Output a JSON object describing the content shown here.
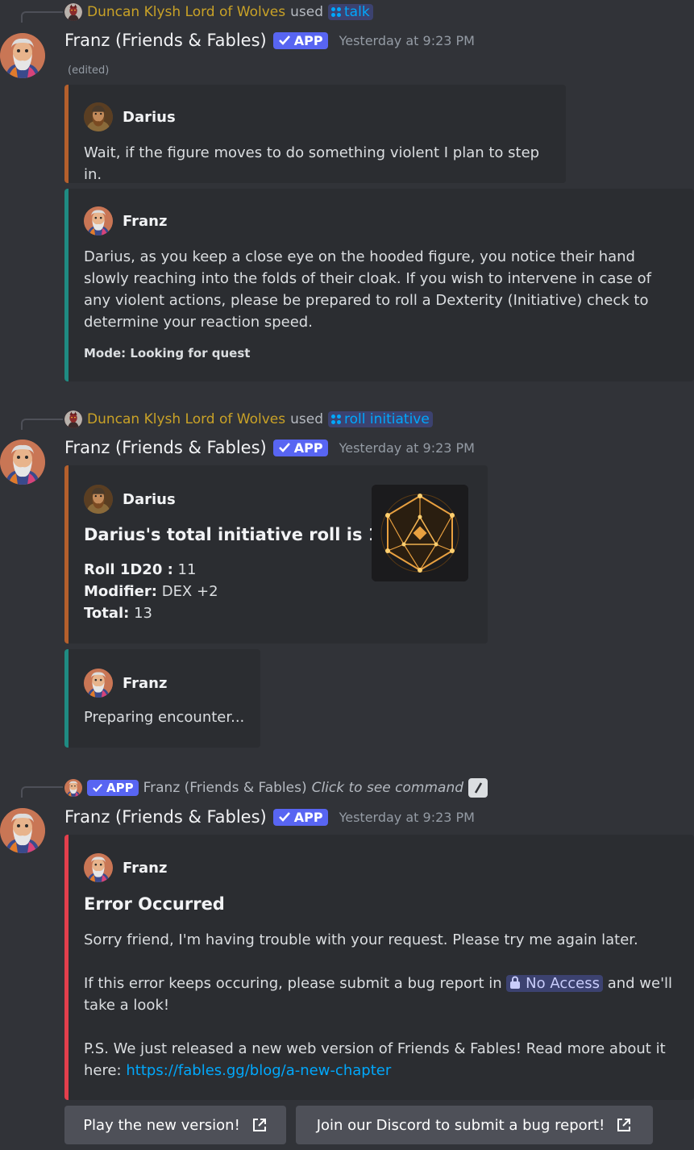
{
  "messages": [
    {
      "reference": {
        "user": "Duncan Klysh Lord of Wolves",
        "used": "used",
        "command": "talk"
      },
      "author": "Franz (Friends & Fables)",
      "app_tag": "APP",
      "timestamp": "Yesterday at 9:23 PM",
      "edited": "(edited)",
      "embeds": [
        {
          "author": "Darius",
          "description": "Wait, if the figure moves to do something violent I plan to step in.",
          "color": "#b45f2c"
        },
        {
          "author": "Franz",
          "description": "Darius, as you keep a close eye on the hooded figure, you notice their hand slowly reaching into the folds of their cloak. If you wish to intervene in case of any violent actions, please be prepared to roll a Dexterity (Initiative) check to determine your reaction speed.",
          "footer": "Mode: Looking for quest",
          "color": "#1f8b82"
        }
      ]
    },
    {
      "reference": {
        "user": "Duncan Klysh Lord of Wolves",
        "used": "used",
        "command": "roll initiative"
      },
      "author": "Franz (Friends & Fables)",
      "app_tag": "APP",
      "timestamp": "Yesterday at 9:23 PM",
      "embeds": [
        {
          "author": "Darius",
          "title": "Darius's total initiative roll is 13!",
          "fields": [
            {
              "name": "Roll 1D20 :",
              "value": "11"
            },
            {
              "name": "Modifier:",
              "value": "DEX +2"
            },
            {
              "name": "Total:",
              "value": "13"
            }
          ],
          "thumbnail": "d20-dice-image",
          "color": "#b45f2c"
        },
        {
          "author": "Franz",
          "description": "Preparing encounter...",
          "color": "#1f8b82"
        }
      ]
    },
    {
      "reference": {
        "app_tag": "APP",
        "user": "Franz (Friends & Fables)",
        "hint": "Click to see command"
      },
      "author": "Franz (Friends & Fables)",
      "app_tag": "APP",
      "timestamp": "Yesterday at 9:23 PM",
      "embeds": [
        {
          "author": "Franz",
          "title": "Error Occurred",
          "line1": "Sorry friend, I'm having trouble with your request. Please try me again later.",
          "line2_before": "If this error keeps occuring, please submit a bug report in",
          "channel": "No Access",
          "line2_after": "and we'll take a look!",
          "line3": "P.S. We just released a new web version of Friends & Fables! Read more about it here:",
          "link": "https://fables.gg/blog/a-new-chapter",
          "color": "#e33f4c"
        }
      ],
      "buttons": [
        {
          "label": "Play the new version!",
          "icon": "external-link-icon"
        },
        {
          "label": "Join our Discord to submit a bug report!",
          "icon": "external-link-icon"
        }
      ]
    }
  ]
}
